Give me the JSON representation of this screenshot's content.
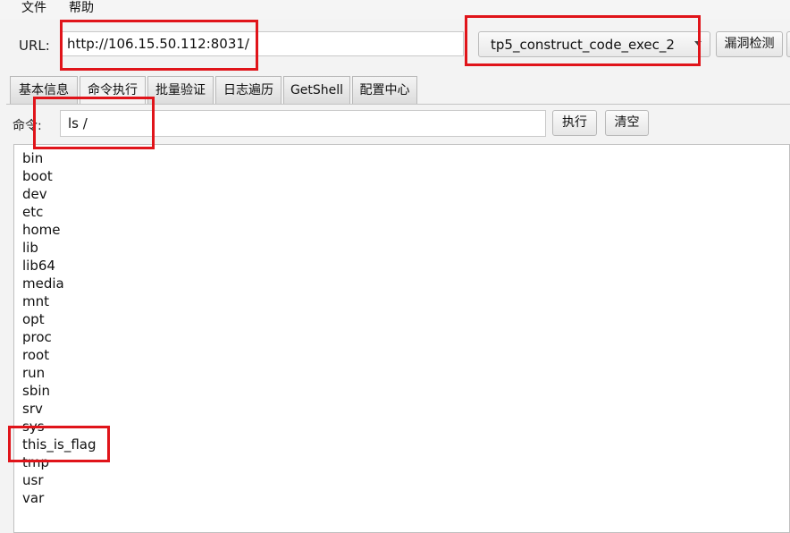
{
  "menu": {
    "file": "文件",
    "help": "帮助"
  },
  "url": {
    "label": "URL:",
    "value": "http://106.15.50.112:8031/"
  },
  "exploit_select": {
    "selected": "tp5_construct_code_exec_2"
  },
  "buttons": {
    "scan": "漏洞检测",
    "execute": "执行",
    "clear": "清空"
  },
  "tabs": [
    {
      "label": "基本信息"
    },
    {
      "label": "命令执行"
    },
    {
      "label": "批量验证"
    },
    {
      "label": "日志遍历"
    },
    {
      "label": "GetShell"
    },
    {
      "label": "配置中心"
    }
  ],
  "command": {
    "label": "命令:",
    "value": "ls /"
  },
  "output_lines": [
    "bin",
    "boot",
    "dev",
    "etc",
    "home",
    "lib",
    "lib64",
    "media",
    "mnt",
    "opt",
    "proc",
    "root",
    "run",
    "sbin",
    "srv",
    "sys",
    "this_is_flag",
    "tmp",
    "usr",
    "var"
  ],
  "colors": {
    "annotation_border": "#e0141a"
  }
}
